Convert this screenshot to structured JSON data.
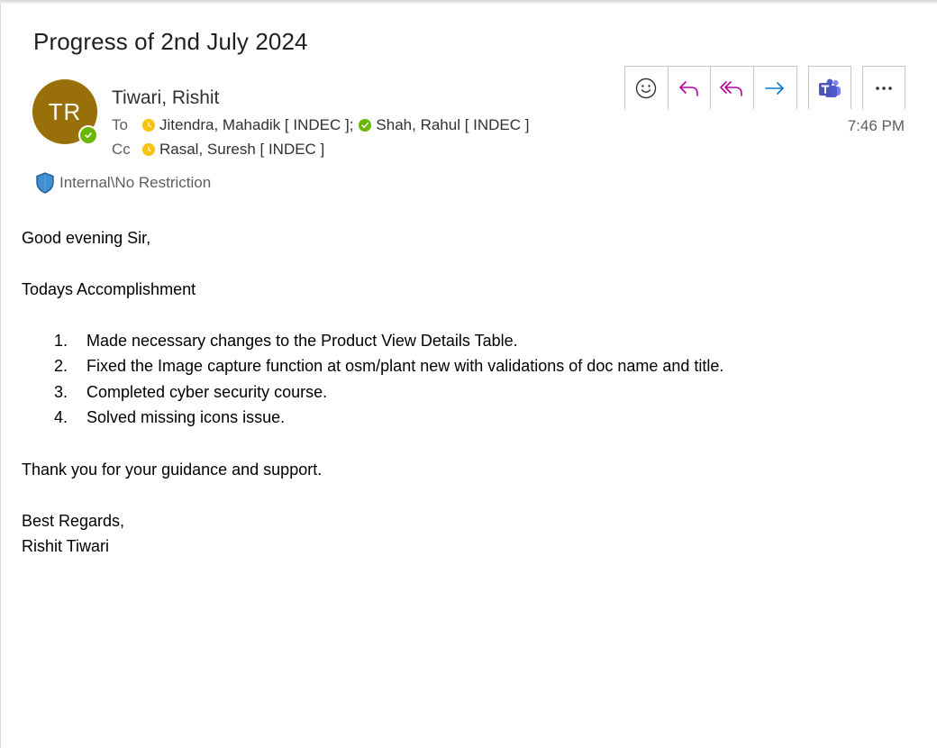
{
  "email": {
    "subject": "Progress of 2nd July 2024",
    "sender": {
      "name": "Tiwari, Rishit",
      "initials": "TR",
      "avatar_color": "#996f09",
      "presence": "available"
    },
    "to_label": "To",
    "cc_label": "Cc",
    "to": [
      {
        "name": "Jitendra, Mahadik [ INDEC ];",
        "presence": "away"
      },
      {
        "name": "Shah, Rahul [ INDEC ]",
        "presence": "available"
      }
    ],
    "cc": [
      {
        "name": "Rasal, Suresh [ INDEC ]",
        "presence": "away"
      }
    ],
    "time": "7:46 PM",
    "sensitivity": "Internal\\No Restriction",
    "body": {
      "greeting": "Good evening Sir,",
      "heading": "Todays Accomplishment",
      "items": [
        {
          "num": "1.",
          "text": "Made necessary changes to the Product View Details Table."
        },
        {
          "num": "2.",
          "text": "Fixed the Image capture function at osm/plant new with validations of doc name and title."
        },
        {
          "num": "3.",
          "text": "Completed cyber security course."
        },
        {
          "num": "4.",
          "text": "Solved missing icons issue."
        }
      ],
      "thanks": "Thank you for your guidance and support.",
      "closing": "Best Regards,",
      "signature": "Rishit Tiwari"
    }
  },
  "toolbar": {
    "buttons": [
      "emoji-react-icon",
      "reply-icon",
      "reply-all-icon",
      "forward-icon",
      "teams-icon",
      "more-options-icon"
    ]
  },
  "colors": {
    "accent_purple": "#b4009e",
    "forward_blue": "#0078d4",
    "teams_purple": "#5059c9",
    "available_green": "#6bb700",
    "away_yellow": "#f8c20e"
  }
}
